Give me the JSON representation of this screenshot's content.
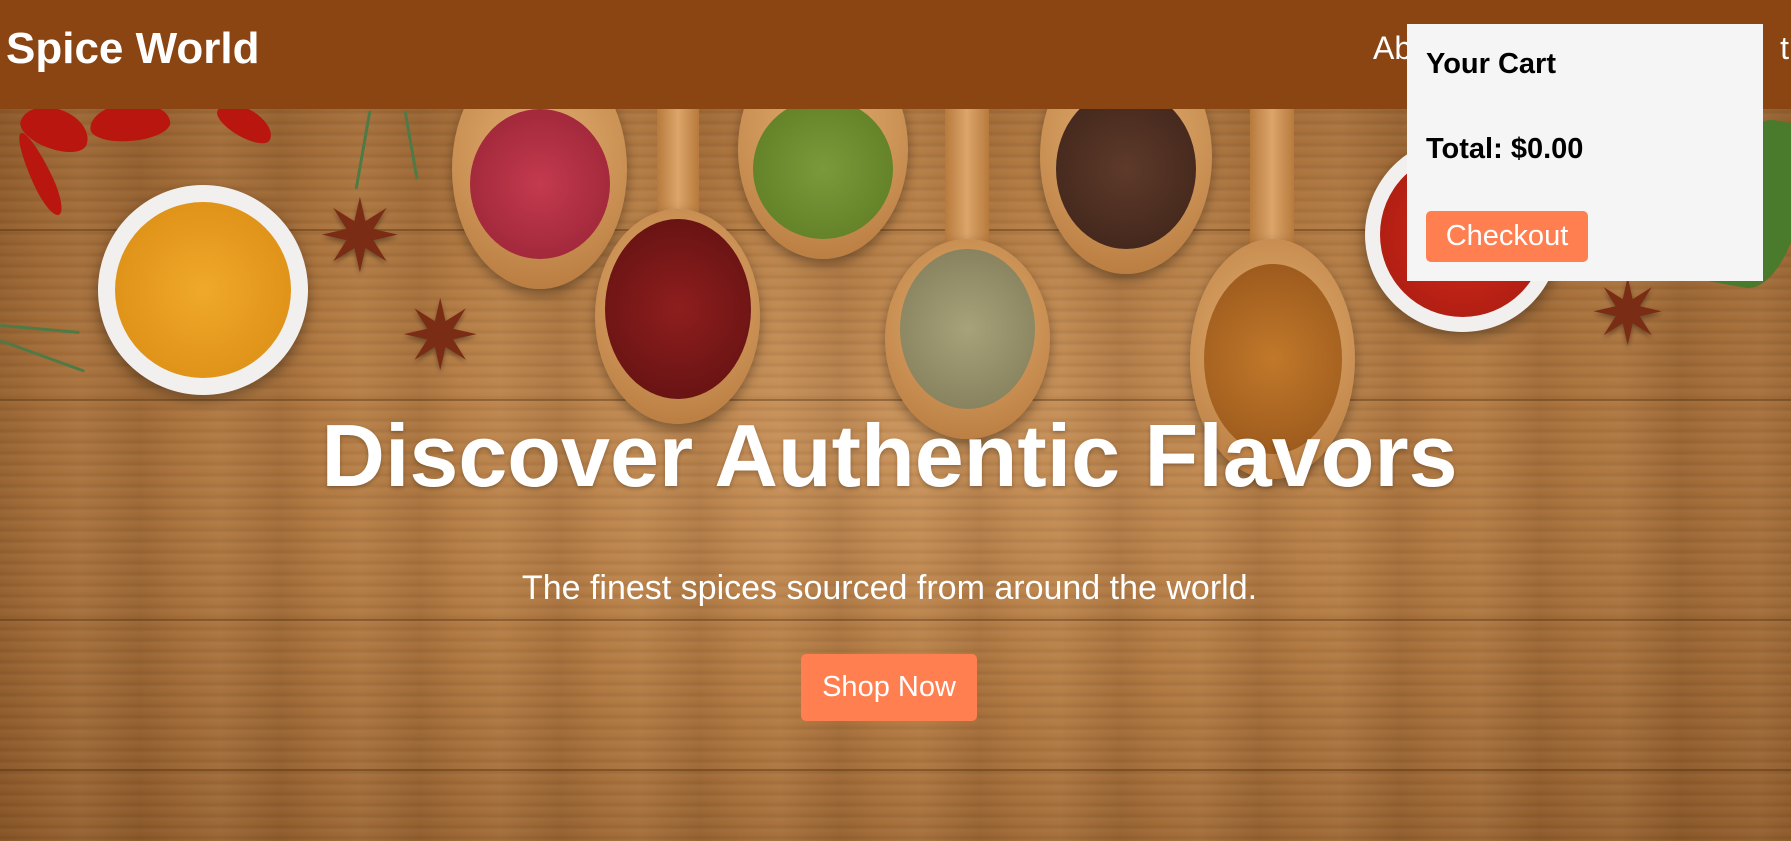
{
  "brand": {
    "name": "Spice World"
  },
  "nav": {
    "about": "Abo",
    "contact": "t"
  },
  "hero": {
    "title": "Discover Authentic Flavors",
    "subtitle": "The finest spices sourced from around the world.",
    "cta": "Shop Now"
  },
  "cart": {
    "title": "Your Cart",
    "total": "Total: $0.00",
    "checkout": "Checkout"
  },
  "colors": {
    "header": "#8b4513",
    "accent": "#ff7f50",
    "cart_bg": "#f5f5f5"
  }
}
